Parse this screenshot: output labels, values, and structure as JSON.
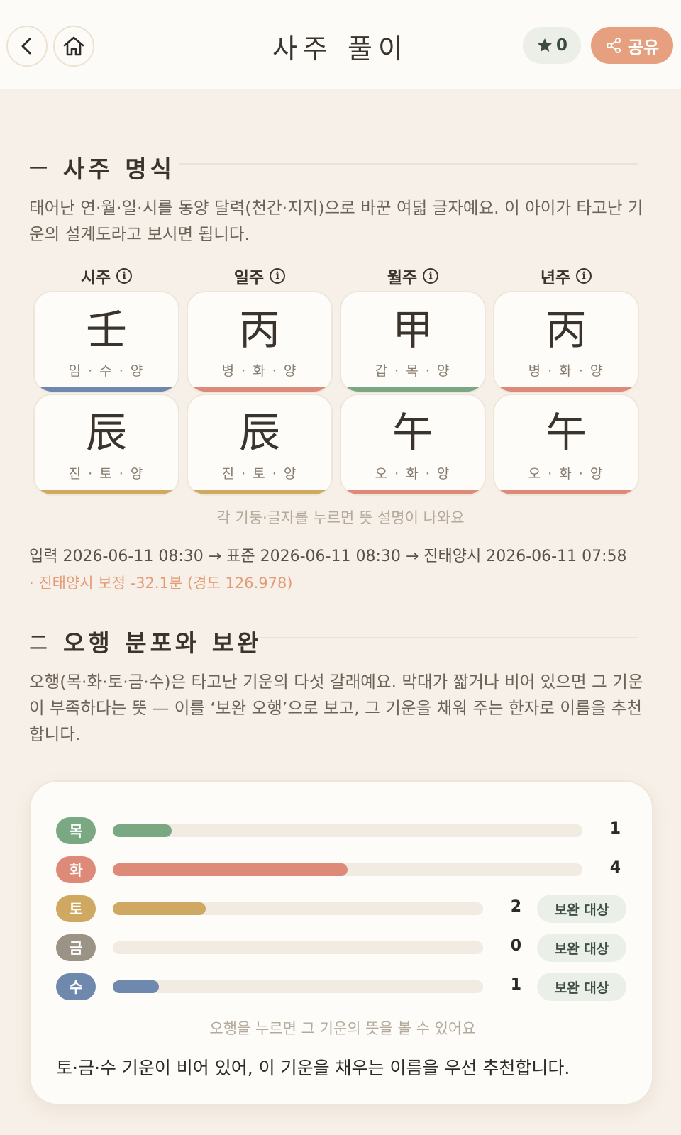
{
  "header": {
    "title": "사주 풀이",
    "favorite_count": "0",
    "share_label": "공유"
  },
  "section1": {
    "number": "一",
    "title": "사주 명식",
    "description": "태어난 연·월·일·시를 동양 달력(천간·지지)으로 바꾼 여덟 글자예요. 이 아이가 타고난 기운의 설계도라고 보시면 됩니다.",
    "pillars": [
      {
        "label": "시주",
        "stem": {
          "char": "壬",
          "reading": "임 · 수 · 양",
          "color": "#6f88ad"
        },
        "branch": {
          "char": "辰",
          "reading": "진 · 토 · 양",
          "color": "#cfa861"
        }
      },
      {
        "label": "일주",
        "stem": {
          "char": "丙",
          "reading": "병 · 화 · 양",
          "color": "#de8a78"
        },
        "branch": {
          "char": "辰",
          "reading": "진 · 토 · 양",
          "color": "#cfa861"
        }
      },
      {
        "label": "월주",
        "stem": {
          "char": "甲",
          "reading": "갑 · 목 · 양",
          "color": "#7aa883"
        },
        "branch": {
          "char": "午",
          "reading": "오 · 화 · 양",
          "color": "#de8a78"
        }
      },
      {
        "label": "년주",
        "stem": {
          "char": "丙",
          "reading": "병 · 화 · 양",
          "color": "#de8a78"
        },
        "branch": {
          "char": "午",
          "reading": "오 · 화 · 양",
          "color": "#de8a78"
        }
      }
    ],
    "hint": "각 기둥·글자를 누르면 뜻 설명이 나와요",
    "time_conversion": "입력 2026-06-11 08:30 → 표준 2026-06-11 08:30 → 진태양시 2026-06-11 07:58",
    "correction_note": "· 진태양시 보정 -32.1분 (경도 126.978)"
  },
  "section2": {
    "number": "二",
    "title": "오행 분포와 보완",
    "description": "오행(목·화·토·금·수)은 타고난 기운의 다섯 갈래예요. 막대가 짧거나 비어 있으면 그 기운이 부족하다는 뜻 — 이를 ‘보완 오행’으로 보고, 그 기운을 채워 주는 한자로 이름을 추천합니다.",
    "elements": [
      {
        "name": "목",
        "count": "1",
        "value": 1,
        "color": "#7aa883",
        "badge": ""
      },
      {
        "name": "화",
        "count": "4",
        "value": 4,
        "color": "#de8a78",
        "badge": ""
      },
      {
        "name": "토",
        "count": "2",
        "value": 2,
        "color": "#cfa861",
        "badge": "보완 대상"
      },
      {
        "name": "금",
        "count": "0",
        "value": 0,
        "color": "#9a9386",
        "badge": "보완 대상"
      },
      {
        "name": "수",
        "count": "1",
        "value": 1,
        "color": "#6f88ad",
        "badge": "보완 대상"
      }
    ],
    "max_value": 8,
    "hint": "오행을 누르면 그 기운의 뜻을 볼 수 있어요",
    "summary": "토·금·수 기운이 비어 있어, 이 기운을 채우는 이름을 우선 추천합니다."
  }
}
